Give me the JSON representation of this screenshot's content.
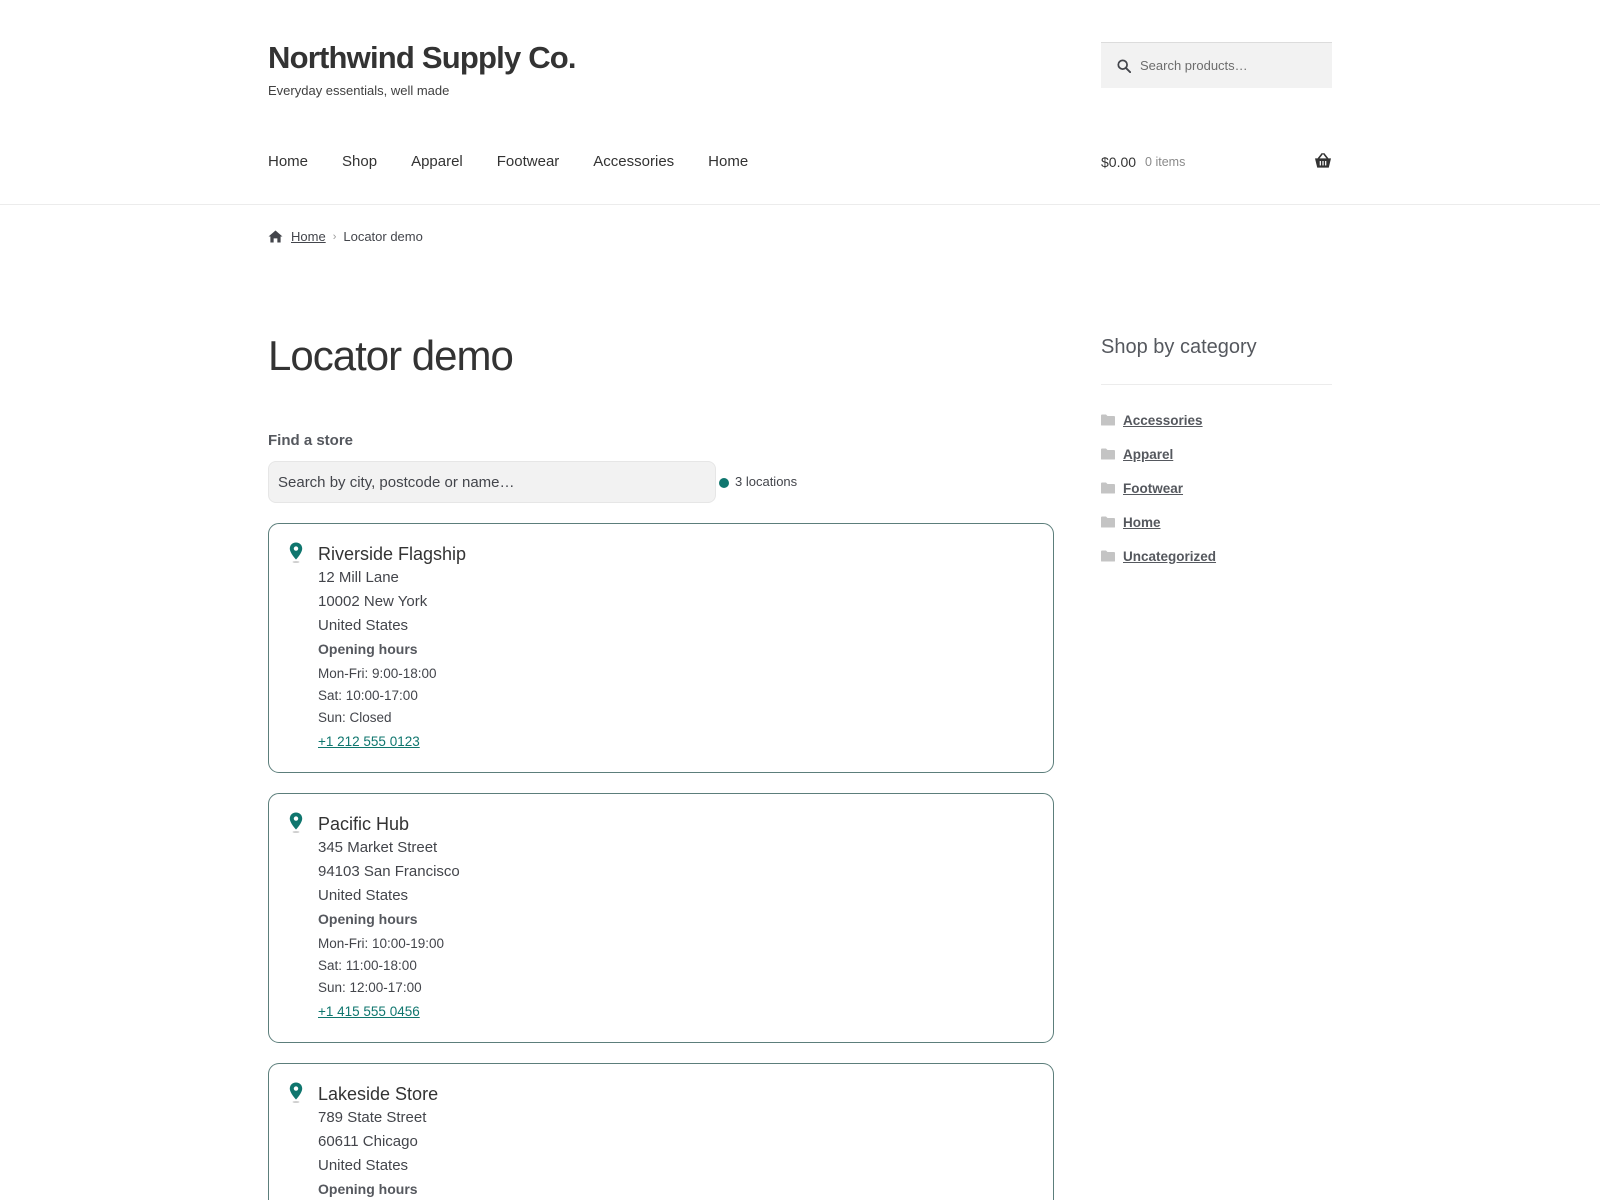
{
  "site": {
    "title": "Northwind Supply Co.",
    "tagline": "Everyday essentials, well made"
  },
  "header_search": {
    "placeholder": "Search products…",
    "icon": "search-icon"
  },
  "nav": {
    "items": [
      "Home",
      "Shop",
      "Apparel",
      "Footwear",
      "Accessories",
      "Home"
    ]
  },
  "cart": {
    "amount": "$0.00",
    "count": "0 items",
    "icon": "basket-icon"
  },
  "breadcrumb": {
    "home": "Home",
    "current": "Locator demo"
  },
  "page": {
    "title": "Locator demo"
  },
  "locator": {
    "label": "Find a store",
    "placeholder": "Search by city, postcode or name…",
    "count_text": "3 locations",
    "accent_color": "#0f766e",
    "stores": [
      {
        "name": "Riverside Flagship",
        "street": "12 Mill Lane",
        "city": "10002 New York",
        "country": "United States",
        "hours_title": "Opening hours",
        "hours": [
          "Mon-Fri: 9:00-18:00",
          "Sat: 10:00-17:00",
          "Sun: Closed"
        ],
        "phone": "+1 212 555 0123"
      },
      {
        "name": "Pacific Hub",
        "street": "345 Market Street",
        "city": "94103 San Francisco",
        "country": "United States",
        "hours_title": "Opening hours",
        "hours": [
          "Mon-Fri: 10:00-19:00",
          "Sat: 11:00-18:00",
          "Sun: 12:00-17:00"
        ],
        "phone": "+1 415 555 0456"
      },
      {
        "name": "Lakeside Store",
        "street": "789 State Street",
        "city": "60611 Chicago",
        "country": "United States",
        "hours_title": "Opening hours"
      }
    ]
  },
  "sidebar": {
    "title": "Shop by category",
    "categories": [
      "Accessories",
      "Apparel",
      "Footwear",
      "Home",
      "Uncategorized"
    ]
  }
}
